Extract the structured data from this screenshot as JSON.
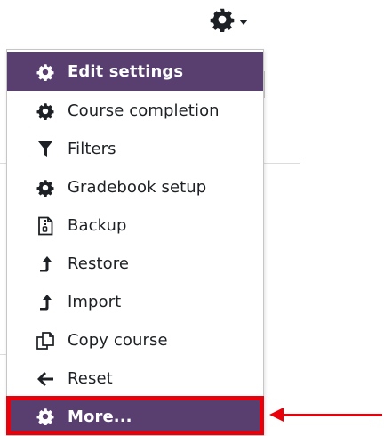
{
  "colors": {
    "accent": "#583f70",
    "highlight": "#e8000b"
  },
  "trigger": {
    "icon": "gear-icon",
    "caret_icon": "chevron-down-icon"
  },
  "menu": {
    "items": [
      {
        "label": "Edit settings",
        "icon": "gear-icon",
        "active": true
      },
      {
        "label": "Course completion",
        "icon": "gear-icon"
      },
      {
        "label": "Filters",
        "icon": "filter-icon"
      },
      {
        "label": "Gradebook setup",
        "icon": "gear-icon"
      },
      {
        "label": "Backup",
        "icon": "file-archive-icon"
      },
      {
        "label": "Restore",
        "icon": "level-up-icon"
      },
      {
        "label": "Import",
        "icon": "level-up-icon"
      },
      {
        "label": "Copy course",
        "icon": "copy-icon"
      },
      {
        "label": "Reset",
        "icon": "arrow-left-icon"
      },
      {
        "label": "More...",
        "icon": "gear-icon",
        "active": true,
        "highlighted": true
      }
    ]
  }
}
